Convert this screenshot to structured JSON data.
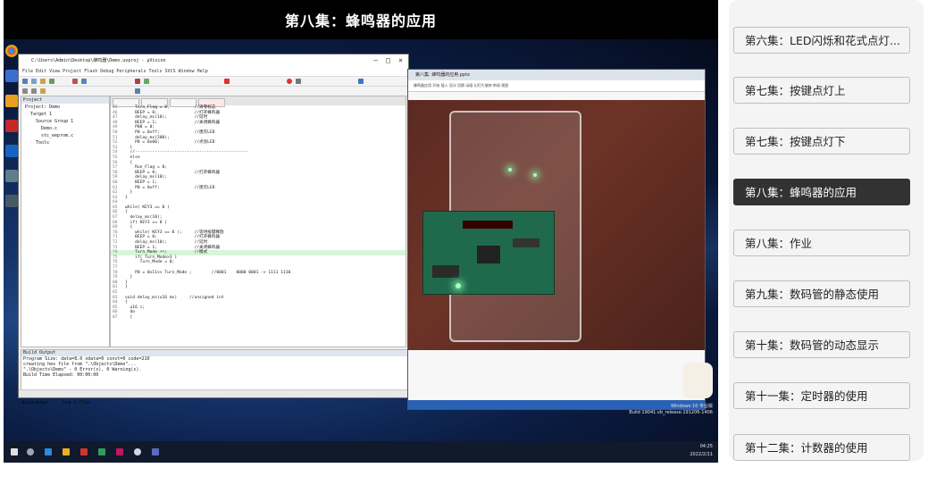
{
  "video": {
    "title": "第八集：蜂鸣器的应用"
  },
  "ide": {
    "title": "C:\\Users\\Admin\\Desktop\\蜂鸣器\\Demo.uvproj - µVision",
    "menu": "File  Edit  View  Project  Flash  Debug  Peripherals  Tools  SVCS  Window  Help",
    "tree": [
      "Project: Demo",
      "Target 1",
      "Source Group 1",
      "Demo.c",
      "stc_eeprom.c",
      "Tools"
    ],
    "code_lines": [
      {
        "n": "45",
        "t": "    Turn_Flag = 0;          //清零标志"
      },
      {
        "n": "46",
        "t": "    BEEP = 0;               //打开蜂鸣器"
      },
      {
        "n": "47",
        "t": "    delay_ms(10);           //延时"
      },
      {
        "n": "48",
        "t": "    BEEP = 1;               //关闭蜂鸣器"
      },
      {
        "n": "49",
        "t": "    P00 = 0;"
      },
      {
        "n": "50",
        "t": "    P0 = 0xff;              //熄灭LED"
      },
      {
        "n": "51",
        "t": "    delay_ms(200);"
      },
      {
        "n": "52",
        "t": "    P0 = 0x00;              //点亮LED"
      },
      {
        "n": "53",
        "t": "  }"
      },
      {
        "n": "54",
        "t": "  //----------------------------------------------"
      },
      {
        "n": "55",
        "t": "  else"
      },
      {
        "n": "56",
        "t": "  {"
      },
      {
        "n": "57",
        "t": "    Run_Flag = 0;"
      },
      {
        "n": "58",
        "t": "    BEEP = 0;               //打开蜂鸣器"
      },
      {
        "n": "59",
        "t": "    delay_ms(10);"
      },
      {
        "n": "60",
        "t": "    BEEP = 1;"
      },
      {
        "n": "61",
        "t": "    P0 = 0xff;              //熄灭LED"
      },
      {
        "n": "62",
        "t": "  }"
      },
      {
        "n": "63",
        "t": "}"
      },
      {
        "n": "64",
        "t": ""
      },
      {
        "n": "65",
        "t": "while( KEY3 == 0 )"
      },
      {
        "n": "66",
        "t": "{"
      },
      {
        "n": "67",
        "t": "  delay_ms(10);"
      },
      {
        "n": "68",
        "t": "  if( KEY3 == 0 )"
      },
      {
        "n": "69",
        "t": "  {"
      },
      {
        "n": "70",
        "t": "    while( KEY3 == 0 );     //等待按键释放"
      },
      {
        "n": "71",
        "t": "    BEEP = 0;               //打开蜂鸣器"
      },
      {
        "n": "72",
        "t": "    delay_ms(10);           //延时"
      },
      {
        "n": "73",
        "t": "    BEEP = 1;               //关闭蜂鸣器"
      },
      {
        "n": "74",
        "t": "    Turn_Mode ++;           //模式"
      },
      {
        "n": "75",
        "t": "    if( Turn_Mode>3 )"
      },
      {
        "n": "76",
        "t": "      Turn_Mode = 0;"
      },
      {
        "n": "77",
        "t": ""
      },
      {
        "n": "78",
        "t": "    P0 = 0x11<< Turn_Mode ;        //0001    0000 0001 -> 1111 1110"
      },
      {
        "n": "79",
        "t": "  }"
      },
      {
        "n": "80",
        "t": "}"
      },
      {
        "n": "81",
        "t": "}"
      },
      {
        "n": "82",
        "t": ""
      },
      {
        "n": "83",
        "t": "void delay_ms(u16 ms)     //unsigned int"
      },
      {
        "n": "84",
        "t": "{"
      },
      {
        "n": "85",
        "t": "  u16 i;"
      },
      {
        "n": "86",
        "t": "  do"
      },
      {
        "n": "87",
        "t": "  {"
      }
    ],
    "build_title": "Build Output",
    "build_lines": [
      "Program Size: data=8.0 xdata=0 const=0 code=210",
      "creating hex file from \".\\Objects\\Demo\"...",
      "\".\\Objects\\Demo\" - 0 Error(s), 0 Warning(s).",
      "Build Time Elapsed:  00:00:00"
    ],
    "build_tabs": [
      "Build Output",
      "Find in Files"
    ]
  },
  "browser": {
    "tab_title": "第八集: 蜂鸣器的应用.pptx",
    "address": "蜂鸣器应用 开始 插入 设计 切换 动画 幻灯片放映 审阅 视图"
  },
  "desktop": {
    "watermark_line1": "Windows 10 专业版",
    "watermark_line2": "Build 19041.vb_release.191206-1406",
    "clock_time": "04:25",
    "clock_date": "2022/2/11"
  },
  "playlist": {
    "items": [
      {
        "label": "第六集：LED闪烁和花式点灯...",
        "active": false
      },
      {
        "label": "第七集：按键点灯上",
        "active": false
      },
      {
        "label": "第七集：按键点灯下",
        "active": false
      },
      {
        "label": "第八集：蜂鸣器的应用",
        "active": true
      },
      {
        "label": "第八集：作业",
        "active": false
      },
      {
        "label": "第九集：数码管的静态使用",
        "active": false
      },
      {
        "label": "第十集：数码管的动态显示",
        "active": false
      },
      {
        "label": "第十一集：定时器的使用",
        "active": false
      },
      {
        "label": "第十二集：计数器的使用",
        "active": false
      }
    ],
    "active_bg": "#323232",
    "item_bg": "#f4f4f4"
  }
}
